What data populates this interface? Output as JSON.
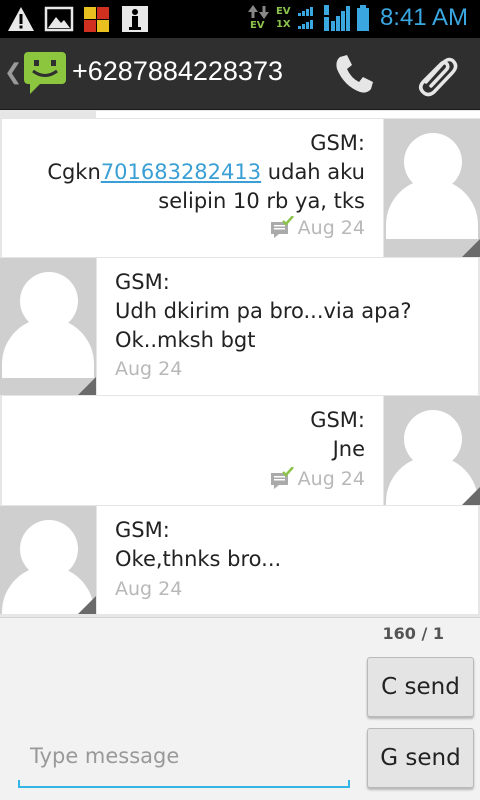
{
  "status_bar": {
    "time": "8:41 AM",
    "icons": [
      "warning-icon",
      "image-icon",
      "app-icon",
      "info-icon",
      "data-arrows-icon",
      "ev-signal-icon",
      "signal-icon",
      "battery-icon"
    ],
    "ev_top": "EV",
    "ev_bottom": "1X",
    "arrows_label": "EV"
  },
  "header": {
    "title": "+6287884228373",
    "icons": [
      "back-caret-icon",
      "messaging-app-icon",
      "phone-icon",
      "paperclip-icon"
    ]
  },
  "messages": [
    {
      "direction": "outgoing",
      "sender": "GSM:",
      "text_prefix": "Cgkn",
      "link": "701683282413",
      "text_suffix": " udah aku\nselipin 10 rb ya, tks",
      "date": "Aug 24",
      "delivered": true
    },
    {
      "direction": "incoming",
      "sender": "GSM:",
      "text": "Udh dkirim pa bro...via apa?\nOk..mksh bgt",
      "date": "Aug 24",
      "delivered": false
    },
    {
      "direction": "outgoing",
      "sender": "GSM:",
      "text": "Jne",
      "date": "Aug 24",
      "delivered": true
    },
    {
      "direction": "incoming",
      "sender": "GSM:",
      "text": "Oke,thnks bro...",
      "date": "Aug 24",
      "delivered": false
    }
  ],
  "compose": {
    "counter": "160 / 1",
    "placeholder": "Type message",
    "send_c_label": "C send",
    "send_g_label": "G send"
  },
  "colors": {
    "accent": "#33b5e5",
    "link": "#3a9fd4",
    "delivered_check": "#8bc34a",
    "action_bar": "#2f2f2f"
  }
}
